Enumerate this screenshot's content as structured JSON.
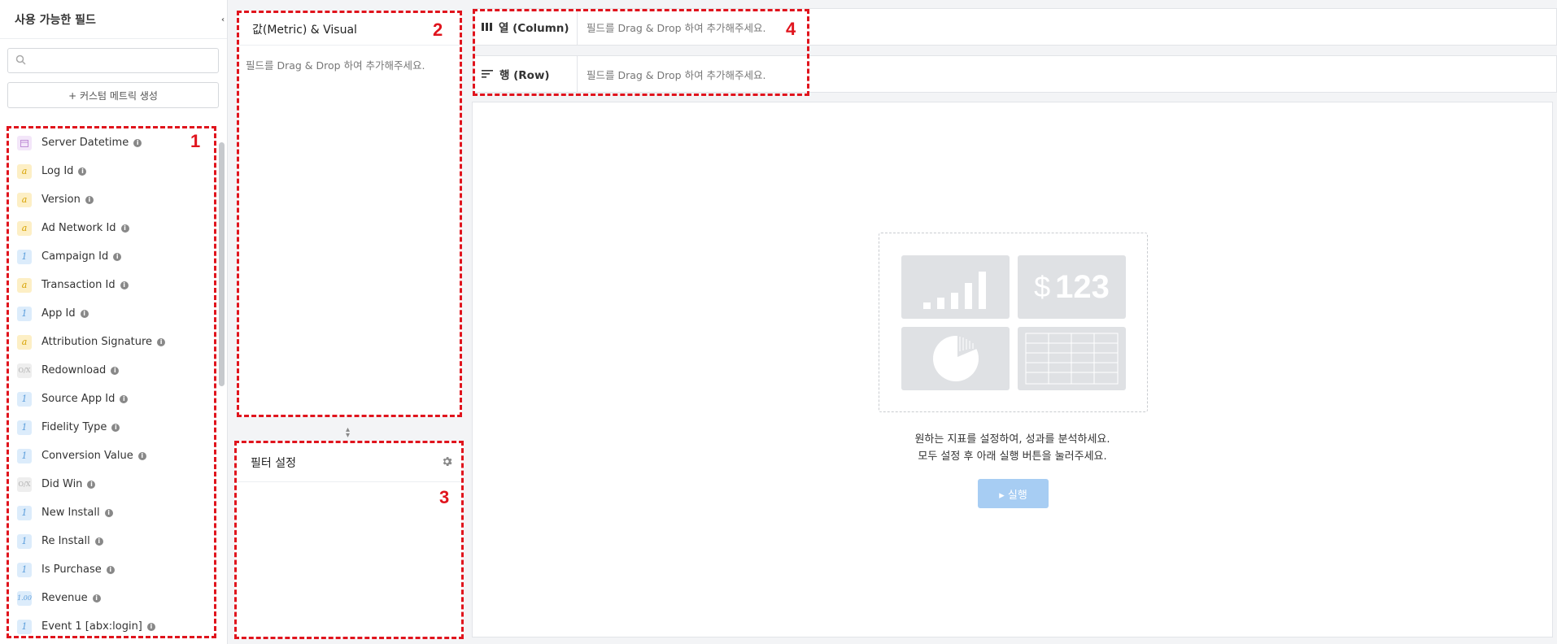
{
  "sidebar": {
    "title": "사용 가능한 필드",
    "collapse_icon": "chevron-left-icon",
    "search": {
      "value": "",
      "placeholder": ""
    },
    "custom_metric_button": "+ 커스텀 메트릭 생성",
    "fields": [
      {
        "name": "Server Datetime",
        "type": "date",
        "icon_text": ""
      },
      {
        "name": "Log Id",
        "type": "string",
        "icon_text": "a"
      },
      {
        "name": "Version",
        "type": "string",
        "icon_text": "a"
      },
      {
        "name": "Ad Network Id",
        "type": "string",
        "icon_text": "a"
      },
      {
        "name": "Campaign Id",
        "type": "number",
        "icon_text": "1"
      },
      {
        "name": "Transaction Id",
        "type": "string",
        "icon_text": "a"
      },
      {
        "name": "App Id",
        "type": "number",
        "icon_text": "1"
      },
      {
        "name": "Attribution Signature",
        "type": "string",
        "icon_text": "a"
      },
      {
        "name": "Redownload",
        "type": "boolean",
        "icon_text": "O/X"
      },
      {
        "name": "Source App Id",
        "type": "number",
        "icon_text": "1"
      },
      {
        "name": "Fidelity Type",
        "type": "number",
        "icon_text": "1"
      },
      {
        "name": "Conversion Value",
        "type": "number",
        "icon_text": "1"
      },
      {
        "name": "Did Win",
        "type": "boolean",
        "icon_text": "O/X"
      },
      {
        "name": "New Install",
        "type": "number",
        "icon_text": "1"
      },
      {
        "name": "Re Install",
        "type": "number",
        "icon_text": "1"
      },
      {
        "name": "Is Purchase",
        "type": "number",
        "icon_text": "1"
      },
      {
        "name": "Revenue",
        "type": "decimal",
        "icon_text": "1.00"
      },
      {
        "name": "Event 1 [abx:login]",
        "type": "number",
        "icon_text": "1"
      }
    ]
  },
  "annotations": [
    "1",
    "2",
    "3",
    "4"
  ],
  "metric_panel": {
    "title": "값(Metric) & Visual",
    "placeholder": "필드를 Drag & Drop 하여 추가해주세요."
  },
  "filter_panel": {
    "title": "필터 설정"
  },
  "column_bar": {
    "label": "열 (Column)",
    "placeholder": "필드를 Drag & Drop 하여 추가해주세요."
  },
  "row_bar": {
    "label": "행 (Row)",
    "placeholder": "필드를 Drag & Drop 하여 추가해주세요."
  },
  "result": {
    "illustration_value": "123",
    "illustration_currency": "$",
    "message_line1": "원하는 지표를 설정하여, 성과를 분석하세요.",
    "message_line2": "모두 설정 후 아래 실행 버튼을 눌러주세요.",
    "run_button": "▸ 실행",
    "run_button_color": "#a7cdf3"
  },
  "colors": {
    "annotation_red": "#e0141d",
    "string_type": "#d6a100",
    "number_type": "#5e9fdc",
    "date_type": "#b57acc"
  }
}
